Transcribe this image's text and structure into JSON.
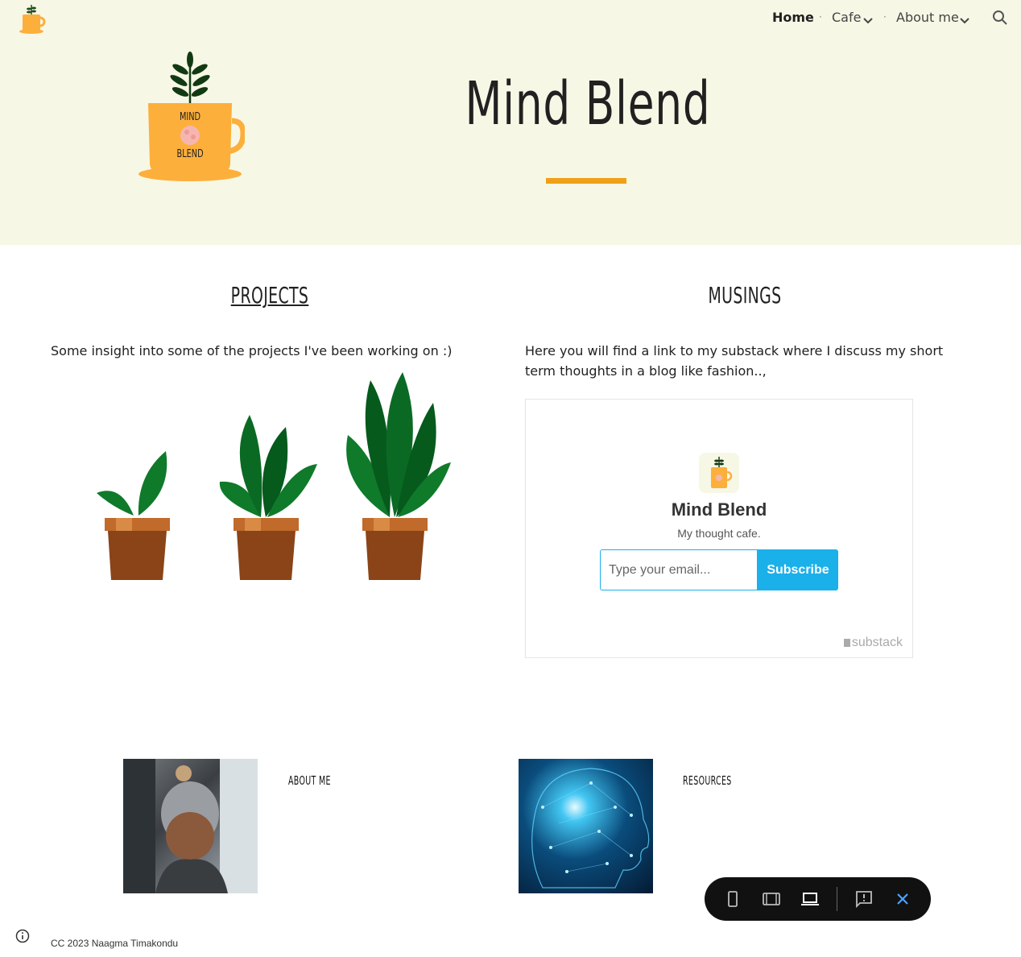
{
  "nav": {
    "items": [
      {
        "label": "Home",
        "active": true
      },
      {
        "label": "Cafe",
        "dropdown": true
      },
      {
        "label": "About me",
        "dropdown": true
      }
    ],
    "separator": "·"
  },
  "header": {
    "title": "Mind Blend",
    "logo_text_1": "MIND",
    "logo_text_2": "BLEND"
  },
  "projects": {
    "heading": "Projects",
    "text": "Some insight into some of the projects I've been working on :)"
  },
  "musings": {
    "heading": "Musings",
    "text": "Here you will find a link to my substack where I discuss my short term thoughts in a blog like fashion..,",
    "embed": {
      "name": "Mind Blend",
      "tagline": "My thought cafe.",
      "email_placeholder": "Type your email...",
      "subscribe_label": "Subscribe",
      "brand": "substack"
    }
  },
  "cards": [
    {
      "label": "About me"
    },
    {
      "label": "Resources"
    }
  ],
  "footer": {
    "text": "CC 2023 Naagma Timakondu"
  },
  "colors": {
    "header_bg": "#f7f7e6",
    "accent": "#f0a018",
    "subscribe": "#1ab0ea",
    "cup": "#fdaf3b"
  }
}
